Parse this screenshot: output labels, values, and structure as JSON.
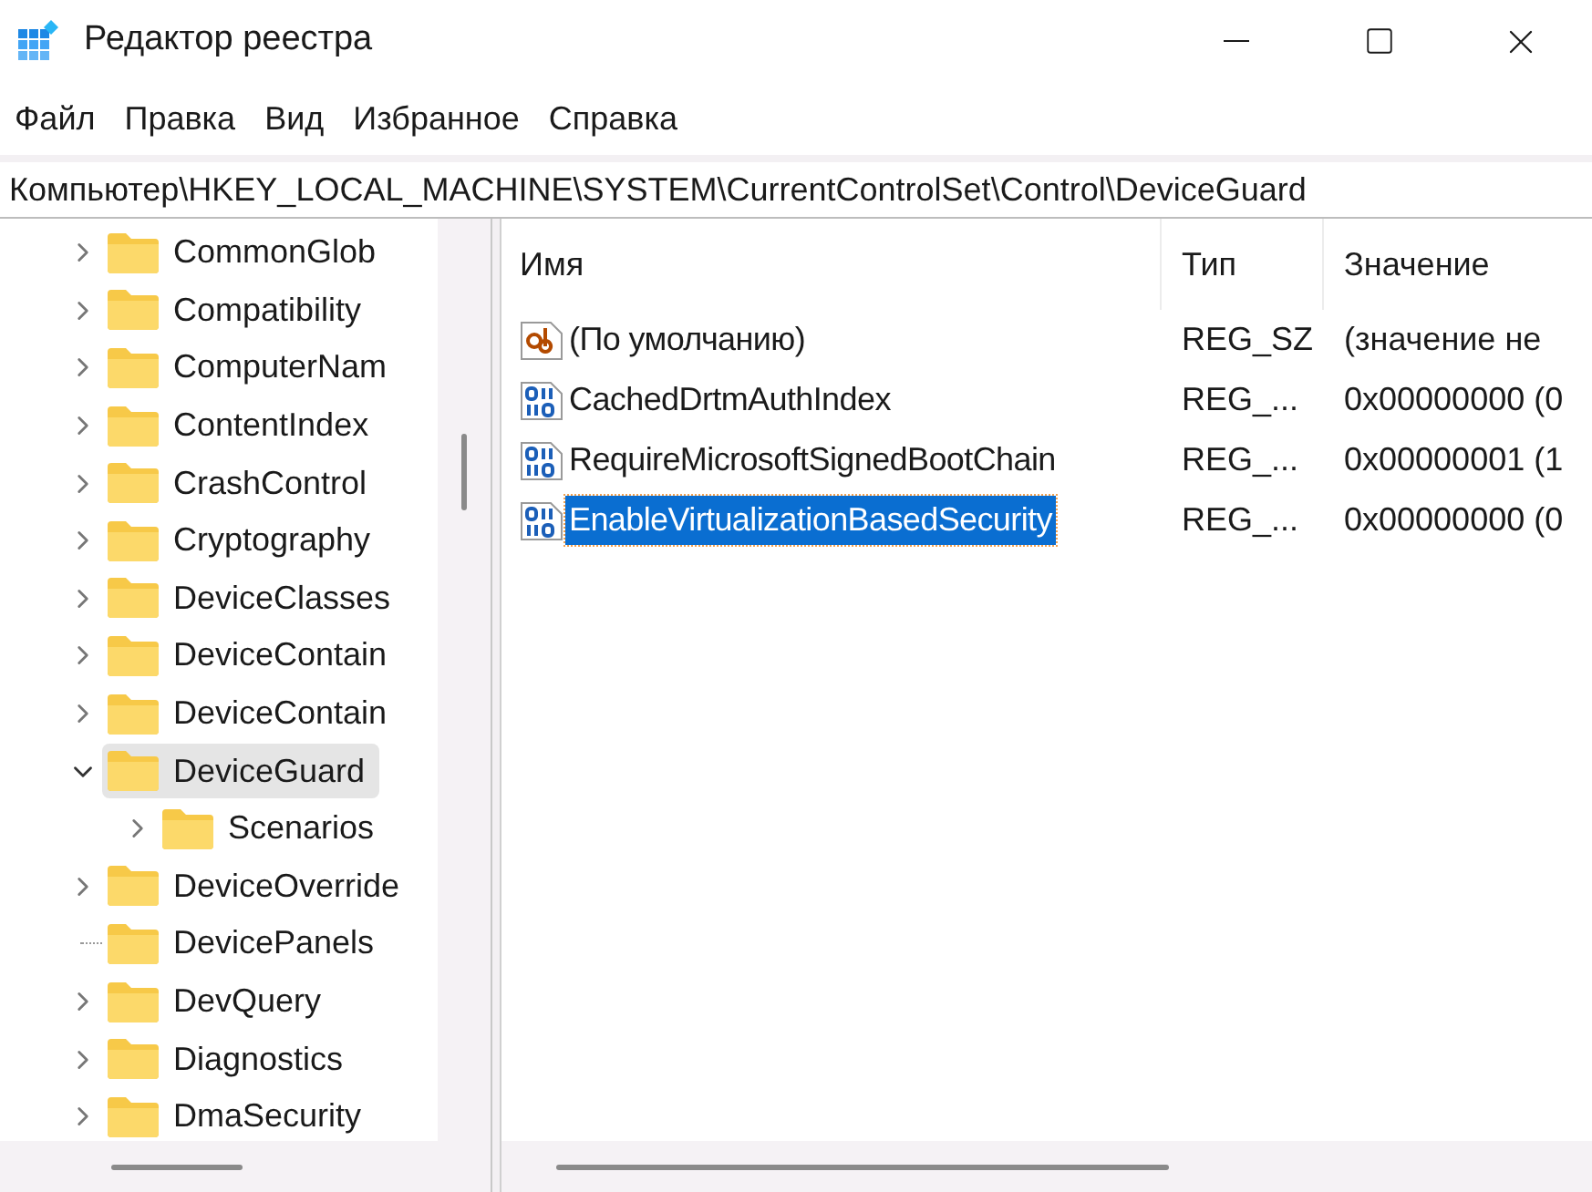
{
  "window": {
    "title": "Редактор реестра"
  },
  "menu": [
    "Файл",
    "Правка",
    "Вид",
    "Избранное",
    "Справка"
  ],
  "address": "Компьютер\\HKEY_LOCAL_MACHINE\\SYSTEM\\CurrentControlSet\\Control\\DeviceGuard",
  "tree": [
    {
      "label": "CommonGlob",
      "expandable": true,
      "expanded": false,
      "selected": false
    },
    {
      "label": "Compatibility",
      "expandable": true,
      "expanded": false,
      "selected": false
    },
    {
      "label": "ComputerNam",
      "expandable": true,
      "expanded": false,
      "selected": false
    },
    {
      "label": "ContentIndex",
      "expandable": true,
      "expanded": false,
      "selected": false
    },
    {
      "label": "CrashControl",
      "expandable": true,
      "expanded": false,
      "selected": false
    },
    {
      "label": "Cryptography",
      "expandable": true,
      "expanded": false,
      "selected": false
    },
    {
      "label": "DeviceClasses",
      "expandable": true,
      "expanded": false,
      "selected": false
    },
    {
      "label": "DeviceContain",
      "expandable": true,
      "expanded": false,
      "selected": false
    },
    {
      "label": "DeviceContain",
      "expandable": true,
      "expanded": false,
      "selected": false
    },
    {
      "label": "DeviceGuard",
      "expandable": true,
      "expanded": true,
      "selected": true,
      "children": [
        {
          "label": "Scenarios",
          "expandable": true,
          "expanded": false,
          "selected": false
        }
      ]
    },
    {
      "label": "DeviceOverride",
      "expandable": true,
      "expanded": false,
      "selected": false
    },
    {
      "label": "DevicePanels",
      "expandable": false,
      "selected": false
    },
    {
      "label": "DevQuery",
      "expandable": true,
      "expanded": false,
      "selected": false
    },
    {
      "label": "Diagnostics",
      "expandable": true,
      "expanded": false,
      "selected": false
    },
    {
      "label": "DmaSecurity",
      "expandable": true,
      "expanded": false,
      "selected": false
    }
  ],
  "table": {
    "columns": [
      "Имя",
      "Тип",
      "Значение"
    ],
    "rows": [
      {
        "kind": "string",
        "name": "(По умолчанию)",
        "type": "REG_SZ",
        "value": "(значение не",
        "selected": false
      },
      {
        "kind": "binary",
        "name": "CachedDrtmAuthIndex",
        "type": "REG_...",
        "value": "0x00000000 (0",
        "selected": false
      },
      {
        "kind": "binary",
        "name": "RequireMicrosoftSignedBootChain",
        "type": "REG_...",
        "value": "0x00000001 (1",
        "selected": false
      },
      {
        "kind": "binary",
        "name": "EnableVirtualizationBasedSecurity",
        "type": "REG_...",
        "value": "0x00000000 (0",
        "selected": true
      }
    ]
  }
}
